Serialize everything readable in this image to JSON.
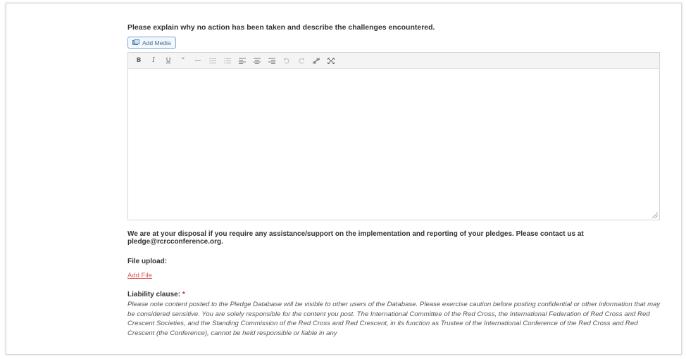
{
  "question": "Please explain why no action has been taken and describe the challenges encountered.",
  "add_media_label": "Add Media",
  "toolbar": {
    "bold": "B",
    "italic": "I",
    "underline": "U",
    "quote": "“",
    "hr": "—"
  },
  "notice": "We are at your disposal if you require any assistance/support on the implementation and reporting of your pledges. Please contact us at pledge@rcrcconference.org.",
  "file_upload_label": "File upload:",
  "add_file_label": "Add File",
  "liability": {
    "label": "Liability clause: ",
    "required_mark": "*",
    "text": "Please note content posted to the Pledge Database will be visible to other users of the Database. Please exercise caution before posting confidential or other information that may be considered sensitive. You are solely responsible for the content you post. The International Committee of the Red Cross, the International Federation of Red Cross and Red Crescent Societies, and the Standing Commission of the Red Cross and Red Crescent, in its function as Trustee of the International Conference of the Red Cross and Red Crescent (the Conference), cannot be held responsible or liable in any"
  }
}
